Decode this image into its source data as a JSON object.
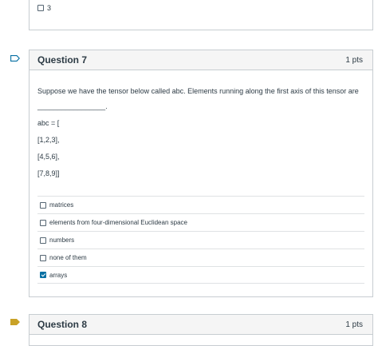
{
  "previous_question": {
    "last_option": {
      "label": "3",
      "checked": false
    }
  },
  "question7": {
    "title": "Question 7",
    "points": "1 pts",
    "flag_icon": "bookmark-outline-icon",
    "text_line1": "Suppose we have the tensor below called abc. Elements running along the first axis of this tensor are",
    "text_blank": "_________________.",
    "code_lines": [
      "abc = [",
      "[1,2,3],",
      "[4,5,6],",
      "[7,8,9]]"
    ],
    "options": [
      {
        "label": "matrices",
        "checked": false
      },
      {
        "label": "elements from four-dimensional Euclidean space",
        "checked": false
      },
      {
        "label": "numbers",
        "checked": false
      },
      {
        "label": "none of them",
        "checked": false
      },
      {
        "label": "arrays",
        "checked": true
      }
    ]
  },
  "question8": {
    "title": "Question 8",
    "points": "1 pts",
    "flag_icon": "bookmark-filled-icon",
    "flag_color": "#c9a227"
  },
  "colors": {
    "checkbox_checked": "#0770a3",
    "flag_outline": "#0770a3",
    "header_bg": "#f5f5f5",
    "border": "#c7cdd1"
  }
}
